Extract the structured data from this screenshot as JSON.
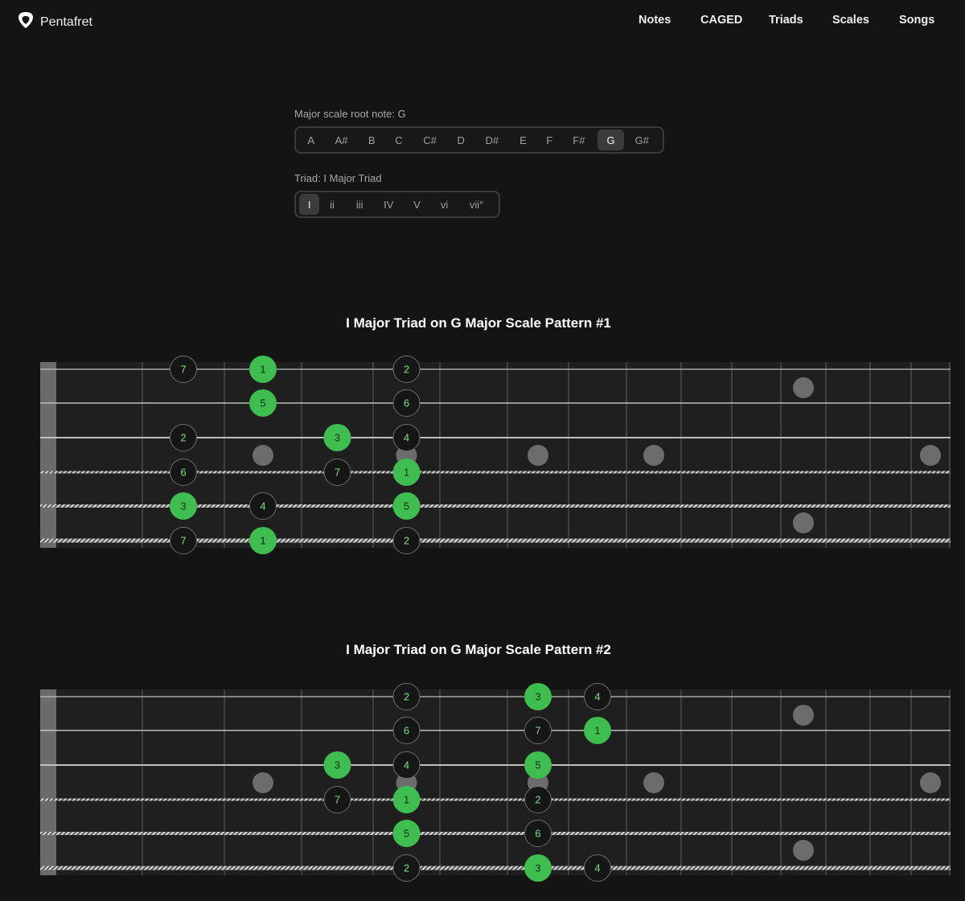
{
  "nav": {
    "brand": "Pentafret",
    "links": [
      "Notes",
      "CAGED",
      "Triads",
      "Scales",
      "Songs"
    ]
  },
  "root_control": {
    "label": "Major scale root note: G",
    "options": [
      "A",
      "A#",
      "B",
      "C",
      "C#",
      "D",
      "D#",
      "E",
      "F",
      "F#",
      "G",
      "G#"
    ],
    "selected": "G"
  },
  "triad_control": {
    "label": "Triad: I Major Triad",
    "options": [
      "I",
      "ii",
      "iii",
      "IV",
      "V",
      "vi",
      "vii°"
    ],
    "selected": "I"
  },
  "colors": {
    "background": "#141414",
    "board": "#1f1f1f",
    "triad_note": "#3dbe4f",
    "triad_text": "#0b2a0f",
    "scale_note": "#161616",
    "scale_text": "#7be07f",
    "inlay": "#7a7a7a"
  },
  "patterns": [
    {
      "title": "I Major Triad on G Major Scale Pattern #1",
      "strings": [
        [
          {
            "fret": 2,
            "degree": "7"
          },
          {
            "fret": 3,
            "degree": "1",
            "triad": true
          },
          {
            "fret": 5,
            "degree": "2"
          }
        ],
        [
          {
            "fret": 3,
            "degree": "5",
            "triad": true
          },
          {
            "fret": 5,
            "degree": "6"
          }
        ],
        [
          {
            "fret": 2,
            "degree": "2"
          },
          {
            "fret": 4,
            "degree": "3",
            "triad": true
          },
          {
            "fret": 5,
            "degree": "4"
          }
        ],
        [
          {
            "fret": 2,
            "degree": "6"
          },
          {
            "fret": 4,
            "degree": "7"
          },
          {
            "fret": 5,
            "degree": "1",
            "triad": true
          }
        ],
        [
          {
            "fret": 2,
            "degree": "3",
            "triad": true
          },
          {
            "fret": 3,
            "degree": "4"
          },
          {
            "fret": 5,
            "degree": "5",
            "triad": true
          }
        ],
        [
          {
            "fret": 2,
            "degree": "7"
          },
          {
            "fret": 3,
            "degree": "1",
            "triad": true
          },
          {
            "fret": 5,
            "degree": "2"
          }
        ]
      ]
    },
    {
      "title": "I Major Triad on G Major Scale Pattern #2",
      "strings": [
        [
          {
            "fret": 5,
            "degree": "2"
          },
          {
            "fret": 7,
            "degree": "3",
            "triad": true
          },
          {
            "fret": 8,
            "degree": "4"
          }
        ],
        [
          {
            "fret": 5,
            "degree": "6"
          },
          {
            "fret": 7,
            "degree": "7"
          },
          {
            "fret": 8,
            "degree": "1",
            "triad": true
          }
        ],
        [
          {
            "fret": 4,
            "degree": "3",
            "triad": true
          },
          {
            "fret": 5,
            "degree": "4"
          },
          {
            "fret": 7,
            "degree": "5",
            "triad": true
          }
        ],
        [
          {
            "fret": 4,
            "degree": "7"
          },
          {
            "fret": 5,
            "degree": "1",
            "triad": true
          },
          {
            "fret": 7,
            "degree": "2"
          }
        ],
        [
          {
            "fret": 5,
            "degree": "5",
            "triad": true
          },
          {
            "fret": 7,
            "degree": "6"
          }
        ],
        [
          {
            "fret": 5,
            "degree": "2"
          },
          {
            "fret": 7,
            "degree": "3",
            "triad": true
          },
          {
            "fret": 8,
            "degree": "4"
          }
        ]
      ]
    }
  ]
}
